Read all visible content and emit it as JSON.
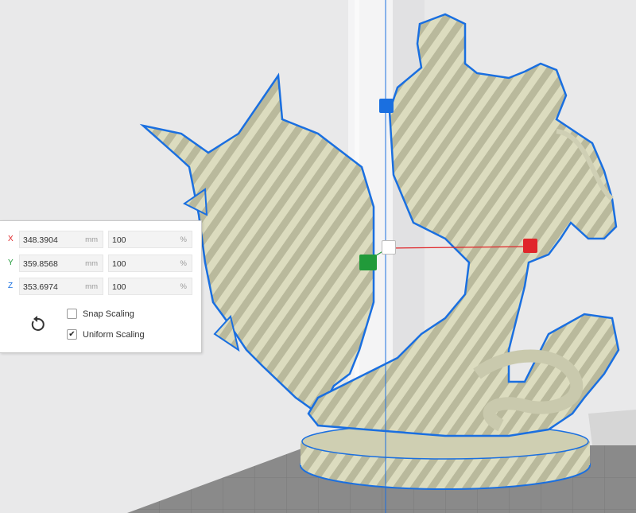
{
  "colors": {
    "background": "#e9e9ea",
    "model_fill": "#dcdcbf",
    "model_stripe": "#b8b89a",
    "outline": "#1a6fe0",
    "axis_x": "#e0262a",
    "axis_y": "#219a3a",
    "axis_z": "#1a6fe0",
    "handle_center": "#ffffff"
  },
  "scale_panel": {
    "rows": [
      {
        "axis": "X",
        "axis_color": "#e0262a",
        "value": "348.3904",
        "unit": "mm",
        "percent": "100",
        "percent_unit": "%"
      },
      {
        "axis": "Y",
        "axis_color": "#219a3a",
        "value": "359.8568",
        "unit": "mm",
        "percent": "100",
        "percent_unit": "%"
      },
      {
        "axis": "Z",
        "axis_color": "#1a6fe0",
        "value": "353.6974",
        "unit": "mm",
        "percent": "100",
        "percent_unit": "%"
      }
    ],
    "reset_icon": "reset-icon",
    "snap_scaling": {
      "label": "Snap Scaling",
      "checked": false
    },
    "uniform_scaling": {
      "label": "Uniform Scaling",
      "checked": true,
      "mark": "✔"
    }
  }
}
